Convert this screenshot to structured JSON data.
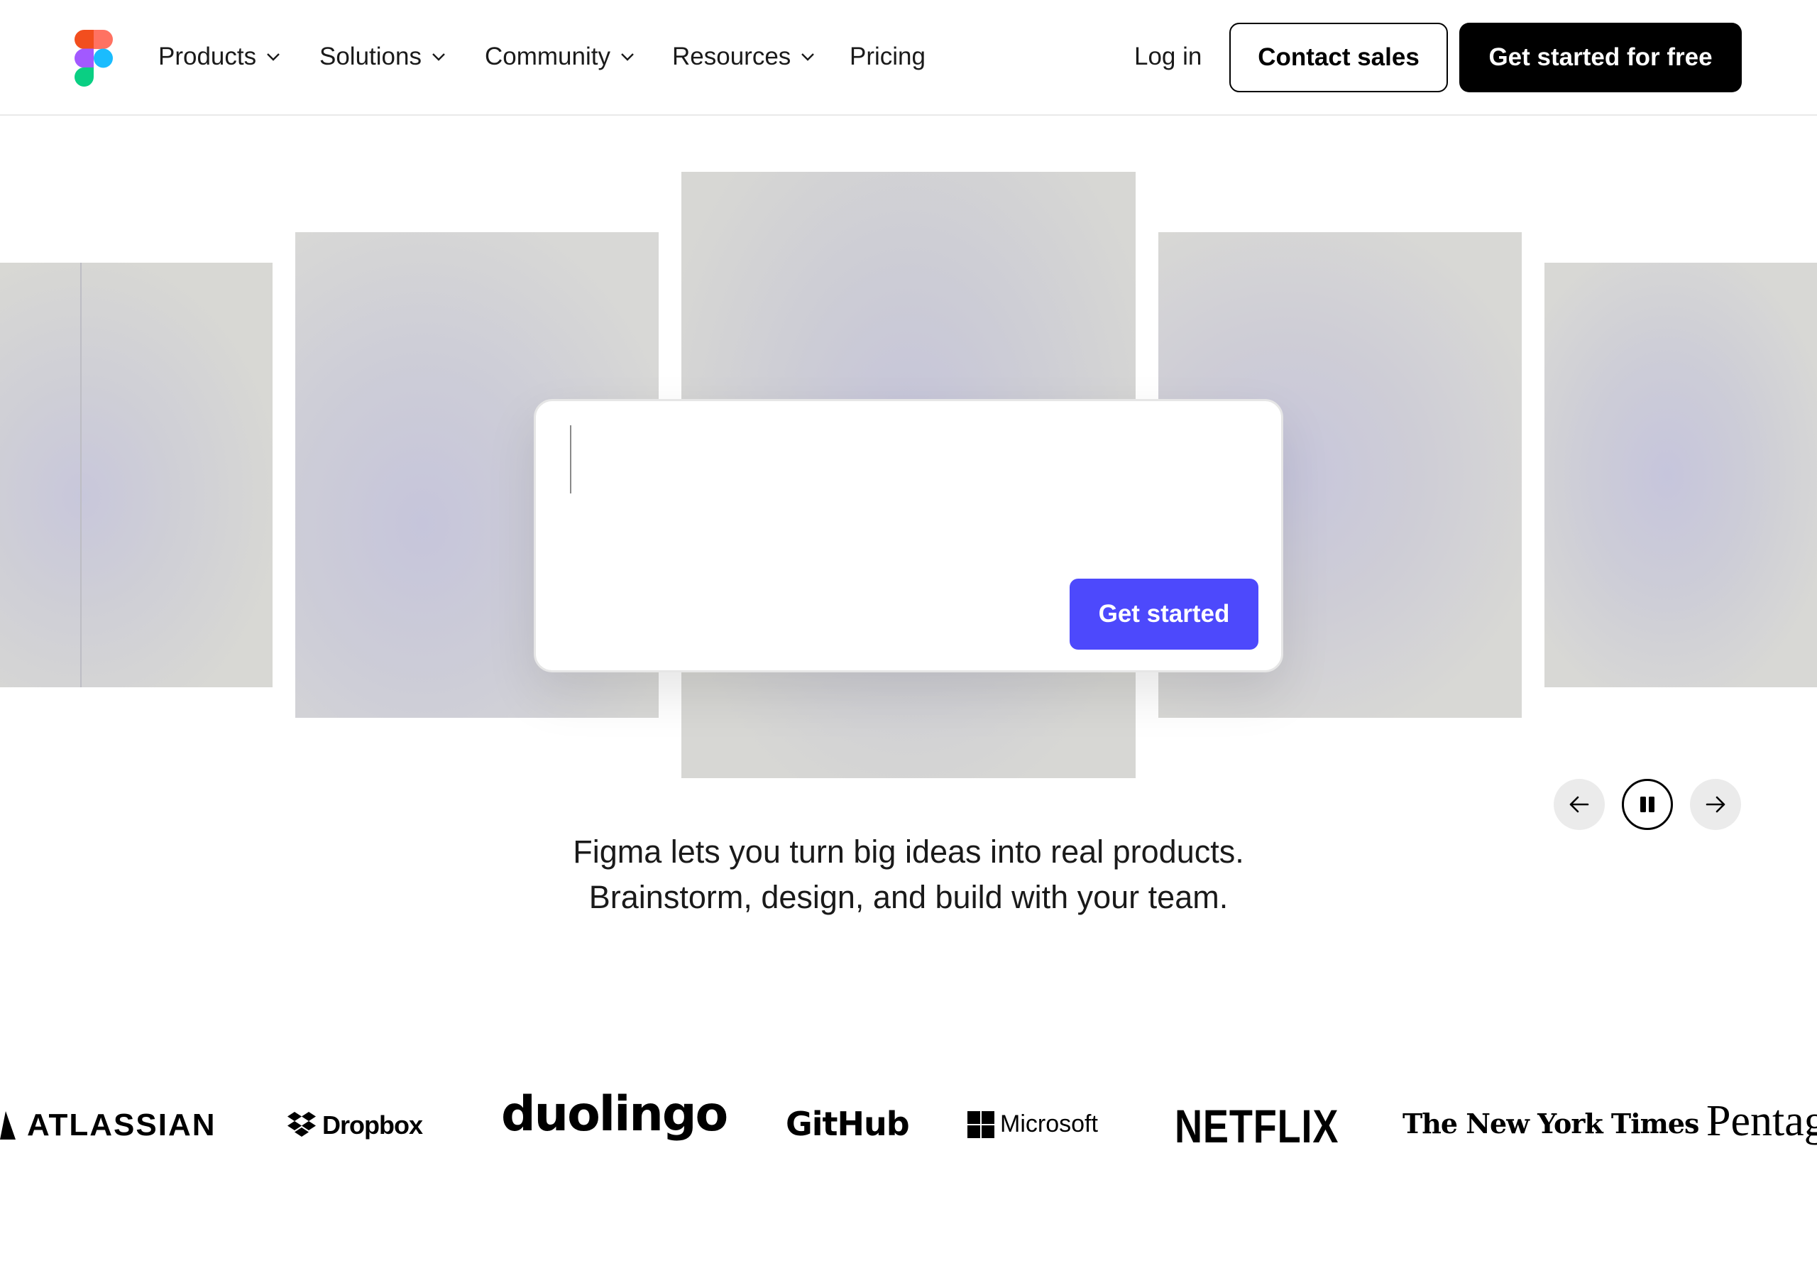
{
  "colors": {
    "accent": "#4d49fc",
    "cta_bg": "#000000",
    "text": "#1a1a1a"
  },
  "header": {
    "logo_icon": "figma-logo-icon",
    "nav": [
      {
        "label": "Products",
        "has_dropdown": true
      },
      {
        "label": "Solutions",
        "has_dropdown": true
      },
      {
        "label": "Community",
        "has_dropdown": true
      },
      {
        "label": "Resources",
        "has_dropdown": true
      },
      {
        "label": "Pricing",
        "has_dropdown": false
      }
    ],
    "login_label": "Log in",
    "contact_sales_label": "Contact sales",
    "get_started_free_label": "Get started for free"
  },
  "hero": {
    "prompt_value": "",
    "get_started_label": "Get started",
    "controls": {
      "prev_icon": "arrow-left-icon",
      "pause_icon": "pause-icon",
      "next_icon": "arrow-right-icon"
    },
    "tagline_line1": "Figma lets you turn big ideas into real products.",
    "tagline_line2": "Brainstorm, design, and build with your team."
  },
  "logos": {
    "atlassian": "ATLASSIAN",
    "dropbox": "Dropbox",
    "duolingo": "duolingo",
    "github": "GitHub",
    "microsoft": "Microsoft",
    "netflix": "NETFLIX",
    "nyt": "The New York Times",
    "pentagram": "Pentag"
  }
}
